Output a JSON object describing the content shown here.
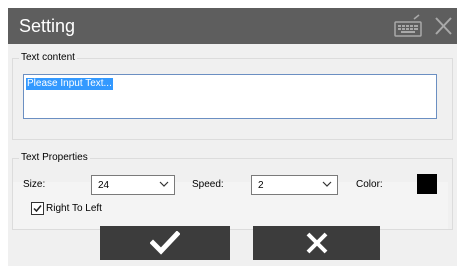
{
  "window": {
    "title": "Setting"
  },
  "titlebar": {
    "keyboard_icon": "keyboard-icon",
    "close_icon": "close-icon"
  },
  "text_content": {
    "group_label": "Text content",
    "value": "Please Input Text..."
  },
  "text_properties": {
    "group_label": "Text Properties",
    "size_label": "Size:",
    "size_value": "24",
    "speed_label": "Speed:",
    "speed_value": "2",
    "color_label": "Color:",
    "color_value": "#000000",
    "rtl_label": "Right To Left",
    "rtl_checked": true
  },
  "buttons": {
    "ok_icon": "checkmark-icon",
    "cancel_icon": "x-icon"
  }
}
